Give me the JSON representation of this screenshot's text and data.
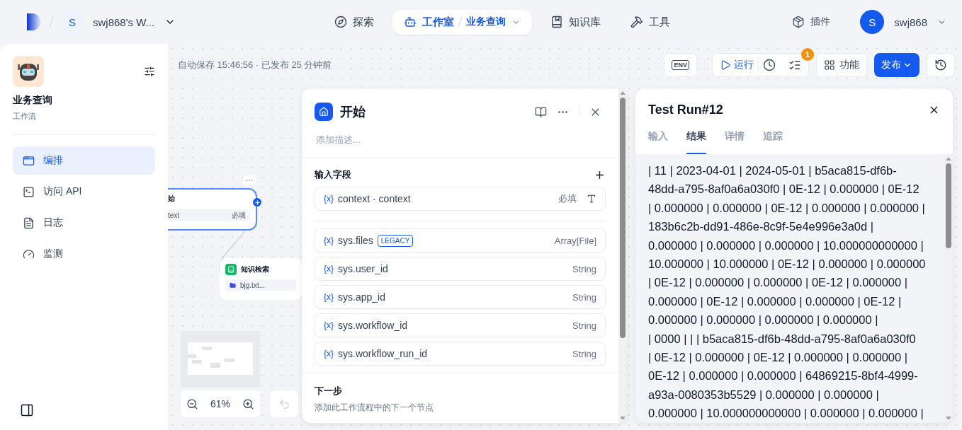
{
  "header": {
    "workspace": {
      "initial": "S",
      "name": "swj868's W..."
    },
    "nav": [
      {
        "label": "探索",
        "selected": false
      },
      {
        "label": "工作室",
        "selected": true,
        "breadcrumb": "业务查询"
      },
      {
        "label": "知识库",
        "selected": false
      },
      {
        "label": "工具",
        "selected": false
      }
    ],
    "plugins": "插件",
    "user": {
      "initial": "S",
      "name": "swj868"
    }
  },
  "sidebar": {
    "app_name": "业务查询",
    "app_type": "工作流",
    "items": [
      {
        "label": "编排",
        "selected": true
      },
      {
        "label": "访问 API",
        "selected": false
      },
      {
        "label": "日志",
        "selected": false
      },
      {
        "label": "监测",
        "selected": false
      }
    ]
  },
  "canvas": {
    "status": "自动保存 15:46:56 · 已发布 25 分钟前",
    "toolbar": {
      "env": "ENV",
      "run": "运行",
      "badge": "1",
      "features": "功能",
      "publish": "发布"
    },
    "start_node": {
      "title": "始",
      "field": "text",
      "required": "必填"
    },
    "knowledge_node": {
      "title": "知识检索",
      "file": "bjg.txt..."
    },
    "zoom": "61%"
  },
  "start_panel": {
    "title": "开始",
    "placeholder": "添加描述...",
    "section": "输入字段",
    "fields": [
      {
        "kind": "user",
        "symbol": "{x}",
        "name": "context · context",
        "required": "必填"
      },
      {
        "kind": "system",
        "symbol": "{x}",
        "name": "sys.files",
        "tag": "LEGACY",
        "type": "Array[File]"
      },
      {
        "kind": "system",
        "symbol": "{x}",
        "name": "sys.user_id",
        "type": "String"
      },
      {
        "kind": "system",
        "symbol": "{x}",
        "name": "sys.app_id",
        "type": "String"
      },
      {
        "kind": "system",
        "symbol": "{x}",
        "name": "sys.workflow_id",
        "type": "String"
      },
      {
        "kind": "system",
        "symbol": "{x}",
        "name": "sys.workflow_run_id",
        "type": "String"
      }
    ],
    "next_step": {
      "title": "下一步",
      "hint": "添加此工作流程中的下一个节点"
    }
  },
  "test_run": {
    "title": "Test Run#12",
    "tabs": [
      {
        "label": "输入",
        "selected": false
      },
      {
        "label": "结果",
        "selected": true
      },
      {
        "label": "详情",
        "selected": false
      },
      {
        "label": "追踪",
        "selected": false
      }
    ],
    "result_lines": [
      "| 11 | 2023-04-01 | 2024-05-01 | b5aca815-df6b-",
      "48dd-a795-8af0a6a030f0 | 0E-12 | 0.000000 | 0E-12",
      "| 0.000000 | 0.000000 | 0E-12 | 0.000000 | 0.000000 |",
      "183b6c2b-dd91-486e-8c9f-5e4e996e3a0d |",
      "0.000000 | 0.000000 | 0.000000 | 10.000000000000 |",
      "10.000000 | 10.000000 | 0E-12 | 0.000000 | 0.000000",
      "| 0E-12 | 0.000000 | 0.000000 | 0E-12 | 0.000000 |",
      "0.000000 | 0E-12 | 0.000000 | 0.000000 | 0E-12 |",
      "0.000000 | 0.000000 | 0.000000 | 0.000000 |",
      "| 0000 | | | b5aca815-df6b-48dd-a795-8af0a6a030f0",
      "| 0E-12 | 0.000000 | 0E-12 | 0.000000 | 0.000000 |",
      "0E-12 | 0.000000 | 0.000000 | 64869215-8bf4-4999-",
      "a93a-0080353b5529 | 0.000000 | 0.000000 |",
      "0.000000 | 10.000000000000 | 0.000000 | 0.000000 |"
    ]
  }
}
